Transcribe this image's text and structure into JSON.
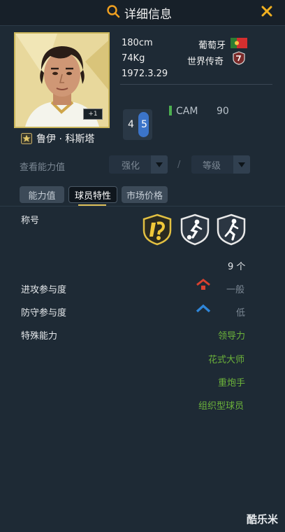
{
  "header": {
    "title": "详细信息",
    "icons": [
      "search-icon",
      "close-icon"
    ]
  },
  "player": {
    "name": "鲁伊 · 科斯塔",
    "height": "180cm",
    "weight": "74Kg",
    "birthdate": "1972.3.29",
    "nationality": "葡萄牙",
    "season": "世界传奇",
    "kit_number": "4",
    "foot_number": "5",
    "position": "CAM",
    "rating": "90",
    "portrait_tag": "+1"
  },
  "view_ability": {
    "label": "查看能力值",
    "enhance_select": "强化",
    "level_select": "等级",
    "separator": "/"
  },
  "tabs": [
    {
      "label": "能力值",
      "active": false
    },
    {
      "label": "球员特性",
      "active": true
    },
    {
      "label": "市场价格",
      "active": false
    }
  ],
  "traits": {
    "title_label": "称号",
    "count": "9 个",
    "attack_label": "进攻参与度",
    "attack_value": "一般",
    "defense_label": "防守参与度",
    "defense_value": "低",
    "special_label": "特殊能力",
    "special_list": [
      "领导力",
      "花式大师",
      "重炮手",
      "组织型球员"
    ]
  },
  "watermark": "酷乐米",
  "colors": {
    "background": "#1e2a35",
    "accent_gold": "#e0c25a",
    "special_green": "#6cb33a",
    "attack_red": "#d9412f",
    "defense_blue": "#2f86d9",
    "position_green": "#4caf50"
  }
}
